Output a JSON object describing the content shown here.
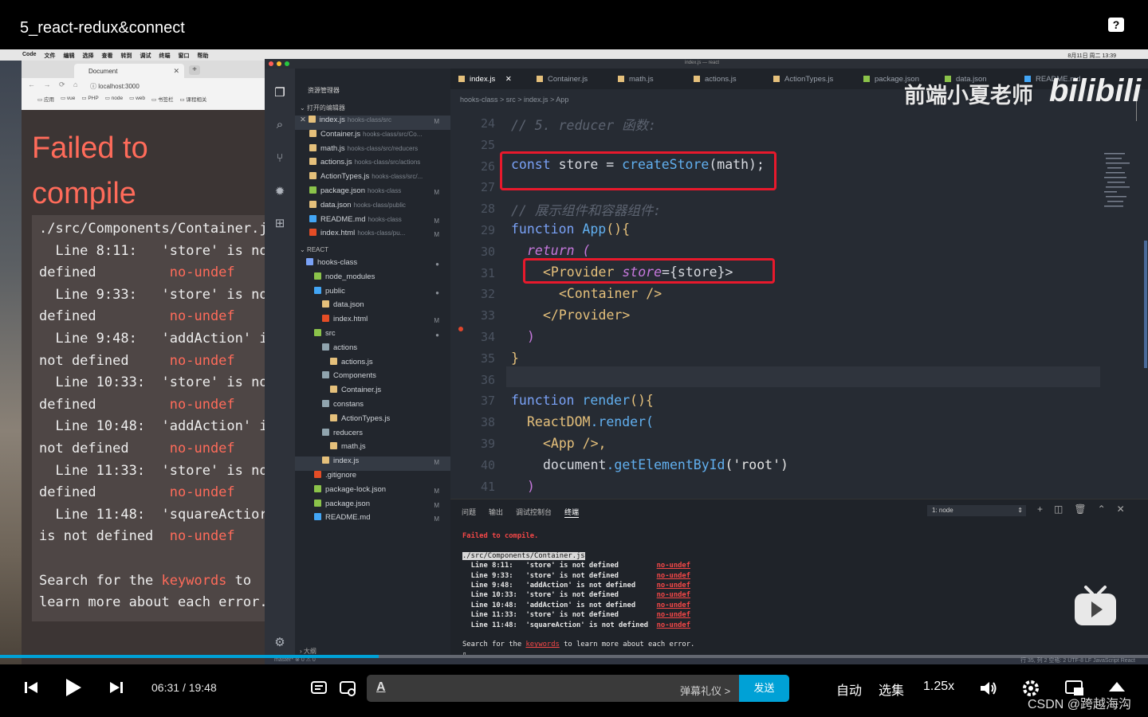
{
  "player": {
    "title": "5_react-redux&connect",
    "help": "?",
    "time_current": "06:31",
    "time_sep": "/",
    "time_total": "19:48",
    "danmaku_etiquette": "弹幕礼仪 >",
    "send": "发送",
    "quality": "自动",
    "episodes": "选集",
    "speed": "1.25x",
    "credit": "CSDN @跨越海沟",
    "progress": 0.33,
    "accent_color": "#00a1d6"
  },
  "mac": {
    "menu": [
      "Code",
      "文件",
      "编辑",
      "选择",
      "查看",
      "转到",
      "调试",
      "终端",
      "窗口",
      "帮助"
    ],
    "status_right": "8月11日 周二 13:39"
  },
  "browser": {
    "tab_title": "Document",
    "url": "localhost:3000",
    "bookmarks": [
      "应用",
      "vue",
      "PHP",
      "node",
      "web",
      "书签栏",
      "课程相关"
    ],
    "error_title_1": "Failed to",
    "error_title_2": "compile",
    "error_lines": [
      "./src/Components/Container.j",
      "  Line 8:11:   'store' is no",
      "defined         no-undef",
      "  Line 9:33:   'store' is no",
      "defined         no-undef",
      "  Line 9:48:   'addAction' i",
      "not defined     no-undef",
      "  Line 10:33:  'store' is no",
      "defined         no-undef",
      "  Line 10:48:  'addAction' i",
      "not defined     no-undef",
      "  Line 11:33:  'store' is no",
      "defined         no-undef",
      "  Line 11:48:  'squareActior",
      "is not defined  no-undef",
      "",
      "Search for the keywords to",
      "learn more about each error."
    ]
  },
  "vscode": {
    "window_title": "index.js — react",
    "explorer_title": "资源管理器",
    "open_editors_label": "打开的编辑器",
    "react_label": "REACT",
    "outline_label": "大纲",
    "open_editors": [
      {
        "name": "index.js",
        "path": "hooks-class/src",
        "badge": "M",
        "color": "#e5c07b"
      },
      {
        "name": "Container.js",
        "path": "hooks-class/src/Co...",
        "badge": "",
        "color": "#e5c07b"
      },
      {
        "name": "math.js",
        "path": "hooks-class/src/reducers",
        "badge": "",
        "color": "#e5c07b"
      },
      {
        "name": "actions.js",
        "path": "hooks-class/src/actions",
        "badge": "",
        "color": "#e5c07b"
      },
      {
        "name": "ActionTypes.js",
        "path": "hooks-class/src/...",
        "badge": "",
        "color": "#e5c07b"
      },
      {
        "name": "package.json",
        "path": "hooks-class",
        "badge": "M",
        "color": "#8bc34a"
      },
      {
        "name": "data.json",
        "path": "hooks-class/public",
        "badge": "",
        "color": "#e5c07b"
      },
      {
        "name": "README.md",
        "path": "hooks-class",
        "badge": "M",
        "color": "#42a5f5"
      },
      {
        "name": "index.html",
        "path": "hooks-class/pu...",
        "badge": "M",
        "color": "#e44d26"
      }
    ],
    "tree": [
      {
        "name": "hooks-class",
        "indent": 1,
        "badge": "●",
        "color": "#7aa2f7"
      },
      {
        "name": "node_modules",
        "indent": 2,
        "badge": "",
        "color": "#8bc34a"
      },
      {
        "name": "public",
        "indent": 2,
        "badge": "●",
        "color": "#42a5f5"
      },
      {
        "name": "data.json",
        "indent": 3,
        "badge": "",
        "color": "#e5c07b"
      },
      {
        "name": "index.html",
        "indent": 3,
        "badge": "M",
        "color": "#e44d26"
      },
      {
        "name": "src",
        "indent": 2,
        "badge": "●",
        "color": "#8bc34a"
      },
      {
        "name": "actions",
        "indent": 3,
        "badge": "",
        "color": "#90a4ae"
      },
      {
        "name": "actions.js",
        "indent": 4,
        "badge": "",
        "color": "#e5c07b"
      },
      {
        "name": "Components",
        "indent": 3,
        "badge": "",
        "color": "#90a4ae"
      },
      {
        "name": "Container.js",
        "indent": 4,
        "badge": "",
        "color": "#e5c07b"
      },
      {
        "name": "constans",
        "indent": 3,
        "badge": "",
        "color": "#90a4ae"
      },
      {
        "name": "ActionTypes.js",
        "indent": 4,
        "badge": "",
        "color": "#e5c07b"
      },
      {
        "name": "reducers",
        "indent": 3,
        "badge": "",
        "color": "#90a4ae"
      },
      {
        "name": "math.js",
        "indent": 4,
        "badge": "",
        "color": "#e5c07b"
      },
      {
        "name": "index.js",
        "indent": 3,
        "badge": "M",
        "color": "#e5c07b"
      },
      {
        "name": ".gitignore",
        "indent": 2,
        "badge": "",
        "color": "#e44d26"
      },
      {
        "name": "package-lock.json",
        "indent": 2,
        "badge": "M",
        "color": "#8bc34a"
      },
      {
        "name": "package.json",
        "indent": 2,
        "badge": "M",
        "color": "#8bc34a"
      },
      {
        "name": "README.md",
        "indent": 2,
        "badge": "M",
        "color": "#42a5f5"
      }
    ],
    "tabs": [
      "index.js",
      "Container.js",
      "math.js",
      "actions.js",
      "ActionTypes.js",
      "package.json",
      "data.json",
      "README.md"
    ],
    "breadcrumb": "hooks-class > src > index.js > App",
    "line_numbers": [
      "24",
      "25",
      "26",
      "27",
      "28",
      "29",
      "30",
      "31",
      "32",
      "33",
      "34",
      "35",
      "36",
      "37",
      "38",
      "39",
      "40",
      "41"
    ],
    "code": {
      "l24": "// 5. reducer 函数:",
      "l26_kw": "const",
      "l26_rest": " store = ",
      "l26_fn": "createStore",
      "l26_arg": "(math);",
      "l28": "// 展示组件和容器组件:",
      "l29_kw": "function",
      "l29_fn": " App",
      "l29_rest": "(){",
      "l30": "return (",
      "l31_open": "<Provider",
      "l31_attr": " store",
      "l31_val": "={store}>",
      "l32": "<Container />",
      "l33": "</Provider>",
      "l34": ")",
      "l35": "}",
      "l37_kw": "function",
      "l37_fn": " render",
      "l37_rest": "(){",
      "l38_obj": "ReactDOM",
      "l38_fn": ".render(",
      "l39": "<App />,",
      "l40_obj": "document",
      "l40_fn": ".getElementById",
      "l40_str": "('root')",
      "l41": ")"
    },
    "panel_tabs": [
      "问题",
      "输出",
      "调试控制台",
      "终端"
    ],
    "terminal_select": "1: node",
    "terminal": {
      "failed": "Failed to compile.",
      "file": "./src/Components/Container.js",
      "rows": [
        {
          "line": "Line 8:11:",
          "msg": "'store' is not defined",
          "rule": "no-undef"
        },
        {
          "line": "Line 9:33:",
          "msg": "'store' is not defined",
          "rule": "no-undef"
        },
        {
          "line": "Line 9:48:",
          "msg": "'addAction' is not defined",
          "rule": "no-undef"
        },
        {
          "line": "Line 10:33:",
          "msg": "'store' is not defined",
          "rule": "no-undef"
        },
        {
          "line": "Line 10:48:",
          "msg": "'addAction' is not defined",
          "rule": "no-undef"
        },
        {
          "line": "Line 11:33:",
          "msg": "'store' is not defined",
          "rule": "no-undef"
        },
        {
          "line": "Line 11:48:",
          "msg": "'squareAction' is not defined",
          "rule": "no-undef"
        }
      ],
      "search_pre": "Search for the ",
      "search_kw": "keywords",
      "search_post": " to learn more about each error."
    },
    "status_left": "master*  ⊗ 0 ⚠ 0",
    "status_right": "行 35, 列 2   空格: 2   UTF-8   LF   JavaScript React"
  },
  "watermark": {
    "text": "前端小夏老师",
    "logo": "bilibili"
  }
}
